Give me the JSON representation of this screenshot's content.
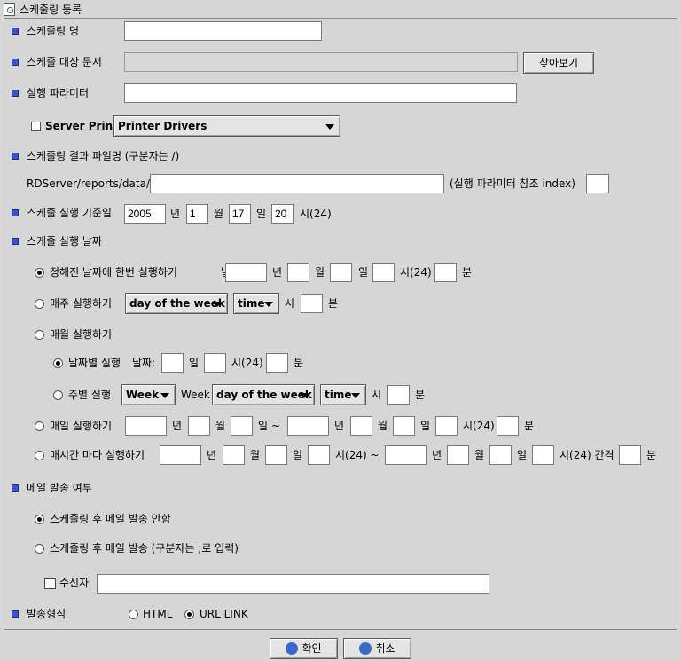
{
  "title": "스케줄링 등록",
  "schedule_name": {
    "label": "스케줄링 명",
    "value": ""
  },
  "target_doc": {
    "label": "스케줄 대상 문서",
    "value": "",
    "browse": "찾아보기"
  },
  "exec_param": {
    "label": "실행 파라미터",
    "value": ""
  },
  "server_print": {
    "label": "Server Print",
    "checked": false,
    "select": "Printer Drivers"
  },
  "result_file": {
    "label": "스케줄링 결과 파일명 (구분자는 /)",
    "prefix": "RDServer/reports/data/",
    "value": "",
    "suffix": "(실행 파라미터 참조 index)",
    "index": ""
  },
  "base_date": {
    "label": "스케줄 실행 기준일",
    "year": "2005",
    "year_unit": "년",
    "month": "1",
    "month_unit": "월",
    "day": "17",
    "day_unit": "일",
    "hour": "20",
    "hour_unit": "시(24)"
  },
  "exec_date_label": "스케줄 실행 날짜",
  "once": {
    "label": "정해진 날짜에 한번 실행하기",
    "date_label": "날짜:",
    "u_year": "년",
    "u_month": "월",
    "u_day": "일",
    "u_hour": "시(24)",
    "u_min": "분"
  },
  "weekly": {
    "label": "매주 실행하기",
    "dow": "day of the week",
    "time": "time",
    "u_hour": "시",
    "u_min": "분"
  },
  "monthly": {
    "label": "매월 실행하기"
  },
  "by_date": {
    "label": "날짜별 실행",
    "date_label": "날짜:",
    "u_day": "일",
    "u_hour": "시(24)",
    "u_min": "분"
  },
  "by_week": {
    "label": "주별 실행",
    "week_sel": "Week",
    "week_text": "Week",
    "dow": "day of the week",
    "time": "time",
    "u_hour": "시",
    "u_min": "분"
  },
  "daily": {
    "label": "매일 실행하기",
    "u_year": "년",
    "u_month": "월",
    "u_day_tilde": "일 ~",
    "u_year2": "년",
    "u_month2": "월",
    "u_day2": "일",
    "u_hour": "시(24)",
    "u_min": "분"
  },
  "hourly": {
    "label": "매시간 마다 실행하기",
    "u_year": "년",
    "u_month": "월",
    "u_day": "일",
    "u_hour_tilde": "시(24) ~",
    "u_year2": "년",
    "u_month2": "월",
    "u_day2": "일",
    "u_hour_interval": "시(24) 간격",
    "u_min": "분"
  },
  "mail": {
    "label": "메일 발송 여부",
    "no_send": "스케줄링 후 메일 발송 안함",
    "send": "스케줄링 후 메일 발송 (구분자는 ;로 입력)",
    "recipient_label": "수신자",
    "recipient": ""
  },
  "send_format": {
    "label": "발송형식",
    "html": "HTML",
    "url": "URL LINK"
  },
  "buttons": {
    "ok": "확인",
    "cancel": "취소"
  },
  "colors": {
    "bullet": "#4050c8",
    "background": "#d6d6d6"
  }
}
